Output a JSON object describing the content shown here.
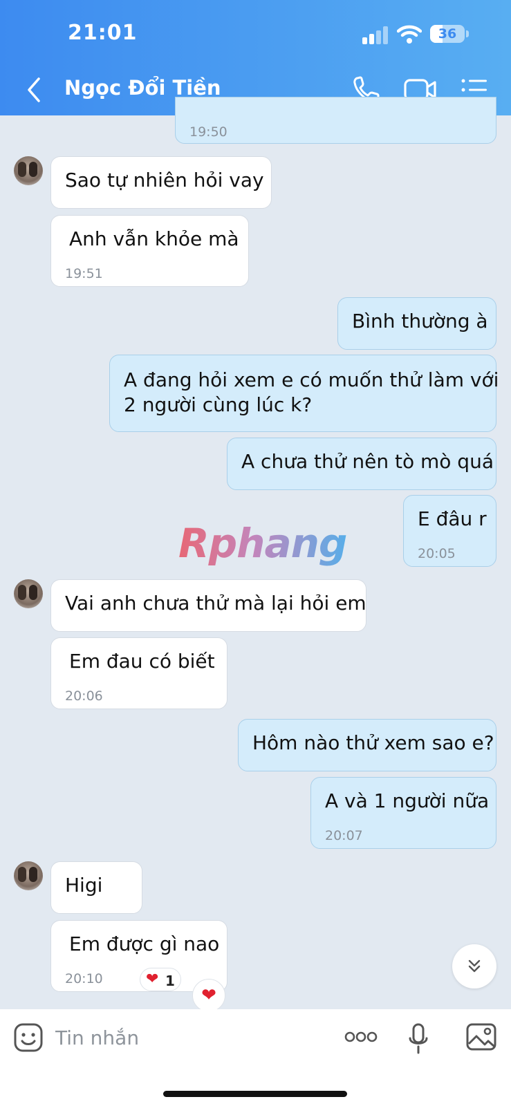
{
  "status_bar": {
    "time": "21:01",
    "battery": "36",
    "battery_level": 0.36
  },
  "header": {
    "contact_name": "Ngọc Đổi Tiền"
  },
  "messages": [
    {
      "dir": "out",
      "text": "",
      "time": "19:50"
    },
    {
      "dir": "in",
      "text": "Sao tự nhiên hỏi vay",
      "time": ""
    },
    {
      "dir": "in",
      "text": "Anh vẫn khỏe mà",
      "time": "19:51"
    },
    {
      "dir": "out",
      "text": "Bình thường à",
      "time": ""
    },
    {
      "dir": "out",
      "text": "A đang hỏi xem e có muốn thử làm với\n2 người cùng lúc k?",
      "time": ""
    },
    {
      "dir": "out",
      "text": "A chưa thử nên tò mò quá",
      "time": ""
    },
    {
      "dir": "out",
      "text": "E đâu r",
      "time": "20:05"
    },
    {
      "dir": "in",
      "text": "Vai anh chưa thử mà lại hỏi em",
      "time": ""
    },
    {
      "dir": "in",
      "text": "Em đau có biết",
      "time": "20:06"
    },
    {
      "dir": "out",
      "text": "Hôm nào thử xem sao e?",
      "time": ""
    },
    {
      "dir": "out",
      "text": "A và 1 người nữa",
      "time": "20:07"
    },
    {
      "dir": "in",
      "text": "Higi",
      "time": ""
    },
    {
      "dir": "in",
      "text": "Em được gì nao",
      "time": "20:10"
    }
  ],
  "reaction": {
    "emoji": "❤",
    "count": "1"
  },
  "react_button": {
    "emoji": "❤"
  },
  "watermark": "Rphang",
  "composer": {
    "placeholder": "Tin nhắn",
    "value": ""
  },
  "colors": {
    "header_start": "#3d8bf0",
    "header_end": "#58aef2",
    "chat_bg": "#e2e9f1",
    "incoming_bubble": "#ffffff",
    "outgoing_bubble": "#d4ecfb",
    "heart": "#e0212f"
  },
  "icons": {
    "back": "chevron-left-icon",
    "call": "phone-icon",
    "video": "video-camera-icon",
    "menu": "list-menu-icon",
    "sticker": "sticker-icon",
    "more": "more-dots-icon",
    "mic": "microphone-icon",
    "image": "image-icon",
    "scroll": "double-chevron-down-icon"
  }
}
